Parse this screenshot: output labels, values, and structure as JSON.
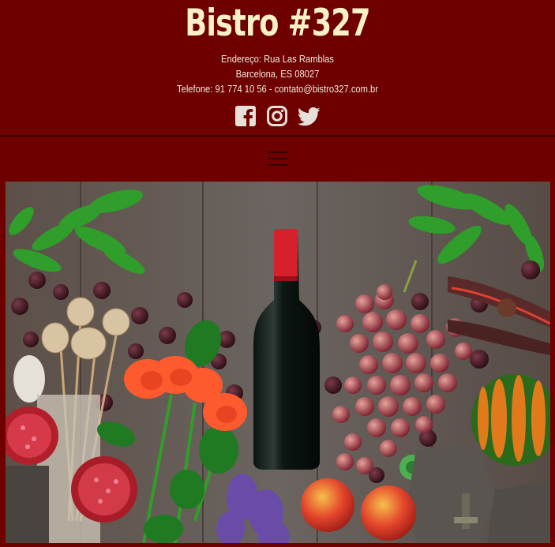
{
  "header": {
    "brand": "Bistro #327",
    "address_line1": "Endereço: Rua Las Ramblas",
    "address_line2": "Barcelona, ES 08027",
    "contact_line": "Telefone: 91 774 10 56 - contato@bistro327.com.br"
  },
  "social": {
    "icons": [
      "facebook-icon",
      "instagram-icon",
      "twitter-icon"
    ],
    "color": "#e6e0d8"
  },
  "nav": {
    "menu_icon": "hamburger-menu-icon"
  },
  "colors": {
    "background": "#6e0000",
    "brand_text": "#fbf1c6",
    "divider": "#2b0000"
  }
}
